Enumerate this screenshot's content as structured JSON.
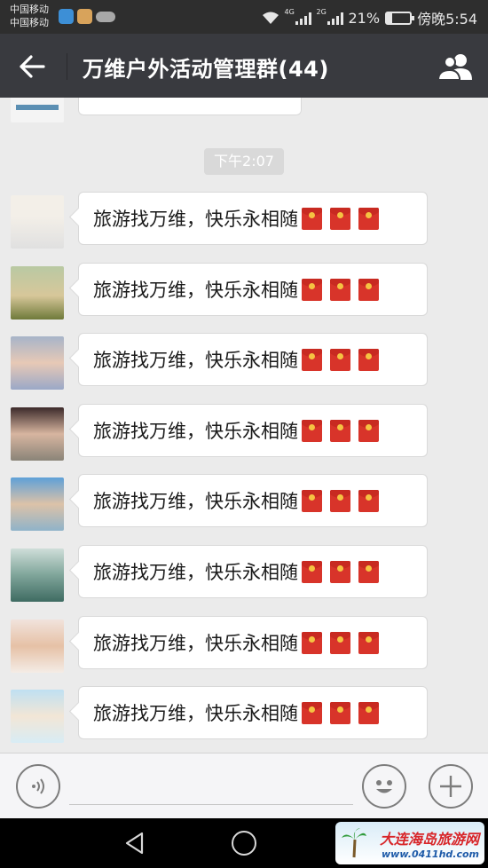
{
  "status_bar": {
    "carrier_1": "中国移动",
    "carrier_2": "中国移动",
    "signal_1_tag": "4G",
    "signal_2_tag": "2G",
    "battery_percent": "21%",
    "battery_level": 0.21,
    "time": "傍晚5:54"
  },
  "header": {
    "title": "万维户外活动管理群(44)",
    "back_icon": "arrow-left-icon",
    "members_icon": "group-members-icon"
  },
  "chat": {
    "timestamp": "下午2:07",
    "messages": [
      {
        "text": "旅游找万维，快乐永相随",
        "avatar_icon": "avatar-red-toy"
      },
      {
        "text": "旅游找万维，快乐永相随",
        "avatar_icon": "avatar-trees"
      },
      {
        "text": "旅游找万维，快乐永相随",
        "avatar_icon": "avatar-girl-pigtails"
      },
      {
        "text": "旅游找万维，快乐永相随",
        "avatar_icon": "avatar-girl-flowers"
      },
      {
        "text": "旅游找万维，快乐永相随",
        "avatar_icon": "avatar-woman-hat"
      },
      {
        "text": "旅游找万维，快乐永相随",
        "avatar_icon": "avatar-woman-green"
      },
      {
        "text": "旅游找万维，快乐永相随",
        "avatar_icon": "avatar-woman-blonde"
      },
      {
        "text": "旅游找万维，快乐永相随",
        "avatar_icon": "avatar-beach"
      }
    ],
    "envelope_icon": "red-envelope-icon"
  },
  "input_bar": {
    "voice_icon": "voice-icon",
    "emoji_icon": "emoji-icon",
    "plus_icon": "plus-icon",
    "input_value": ""
  },
  "watermark": {
    "name": "大连海岛旅游网",
    "url": "www.0411hd.com"
  },
  "colors": {
    "status_bar": "#2e2e2e",
    "title_bar": "#393a3f",
    "chat_bg": "#ebebeb",
    "bubble": "#ffffff",
    "envelope": "#d8342a"
  }
}
